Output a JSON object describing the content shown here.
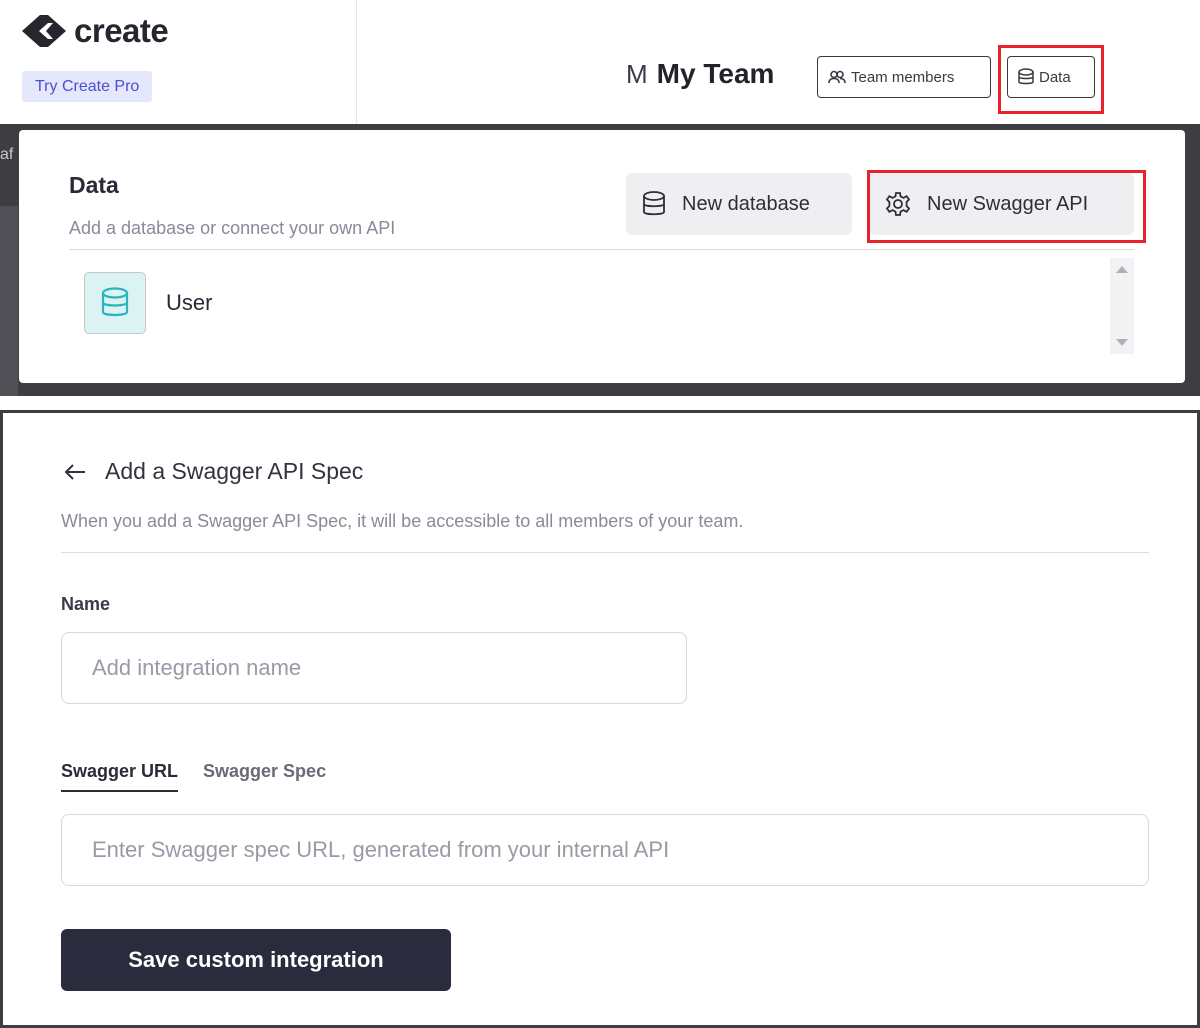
{
  "app": {
    "logo_text": "create",
    "try_pro_label": "Try Create Pro"
  },
  "header": {
    "team_avatar_letter": "M",
    "team_name": "My Team",
    "team_members_label": "Team members",
    "data_label": "Data"
  },
  "data_panel": {
    "title": "Data",
    "subtitle": "Add a database or connect your own API",
    "new_database_label": "New database",
    "new_swagger_label": "New Swagger API",
    "items": [
      {
        "label": "User",
        "icon": "database-icon"
      }
    ]
  },
  "swagger_form": {
    "title": "Add a Swagger API Spec",
    "subtitle": "When you add a Swagger API Spec, it will be accessible to all members of your team.",
    "name_label": "Name",
    "name_placeholder": "Add integration name",
    "name_value": "",
    "tabs": [
      {
        "label": "Swagger URL",
        "active": true
      },
      {
        "label": "Swagger Spec",
        "active": false
      }
    ],
    "url_placeholder": "Enter Swagger spec URL, generated from your internal API",
    "url_value": "",
    "save_label": "Save custom integration"
  },
  "colors": {
    "highlight": "#e8222a",
    "accent": "#4a4fd6",
    "db_tile_bg": "#dcf3f4",
    "db_icon": "#2bb5c0",
    "primary_button": "#2a2b3d",
    "backdrop": "#3e3e42"
  }
}
